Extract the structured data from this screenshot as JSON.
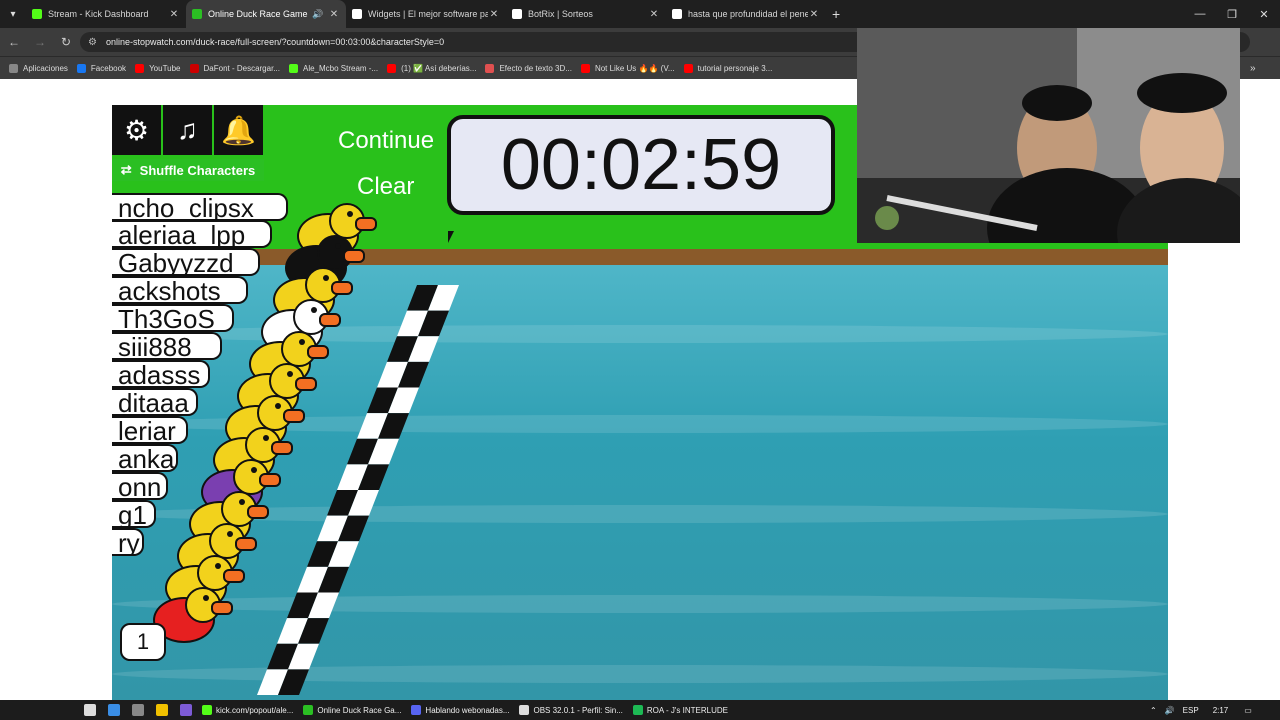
{
  "tabs": [
    {
      "title": "Stream - Kick Dashboard",
      "favicon_color": "#53fc18",
      "active": false
    },
    {
      "title": "Online Duck Race Game",
      "favicon_color": "#2bbf23",
      "active": true
    },
    {
      "title": "Widgets | El mejor software par",
      "favicon_color": "#ffffff",
      "active": false
    },
    {
      "title": "BotRix | Sorteos",
      "favicon_color": "#ffffff",
      "active": false
    },
    {
      "title": "hasta que profundidad el pene",
      "favicon_color": "#ffffff",
      "active": false
    }
  ],
  "address": {
    "url": "online-stopwatch.com/duck-race/full-screen/?countdown=00:03:00&characterStyle=0"
  },
  "bookmarks": [
    {
      "label": "Aplicaciones",
      "color": "#888888"
    },
    {
      "label": "Facebook",
      "color": "#1877f2"
    },
    {
      "label": "YouTube",
      "color": "#ff0000"
    },
    {
      "label": "DaFont - Descargar...",
      "color": "#cc0000"
    },
    {
      "label": "Ale_Mcbo Stream -...",
      "color": "#53fc18"
    },
    {
      "label": "(1) ✅ Así deberías...",
      "color": "#ff0000"
    },
    {
      "label": "Efecto de texto 3D...",
      "color": "#e05050"
    },
    {
      "label": "Not Like Us 🔥🔥 (V...",
      "color": "#ff0000"
    },
    {
      "label": "tutorial personaje 3...",
      "color": "#ff0000"
    }
  ],
  "game": {
    "shuffle_label": "Shuffle Characters",
    "continue_label": "Continue",
    "clear_label": "Clear",
    "timer": "00:02:59",
    "names": [
      "ncho_clipsx",
      "aleriaa_lpp",
      "Gabyyzzd",
      "ackshots",
      "Th3GoS",
      "siii888",
      "adasss",
      "ditaaa",
      "leriar",
      "anka",
      "onn",
      "g1",
      "ry"
    ],
    "badge_number": "1"
  },
  "taskbar": {
    "apps": [
      {
        "label": "kick.com/popout/ale...",
        "color": "#53fc18"
      },
      {
        "label": "Online Duck Race Ga...",
        "color": "#2bbf23"
      },
      {
        "label": "Hablando webonadas...",
        "color": "#5865f2"
      },
      {
        "label": "OBS 32.0.1 - Perfil: Sin...",
        "color": "#dddddd"
      },
      {
        "label": "ROA - J's INTERLUDE",
        "color": "#1db954"
      }
    ],
    "lang": "ESP",
    "time": "2:17"
  }
}
